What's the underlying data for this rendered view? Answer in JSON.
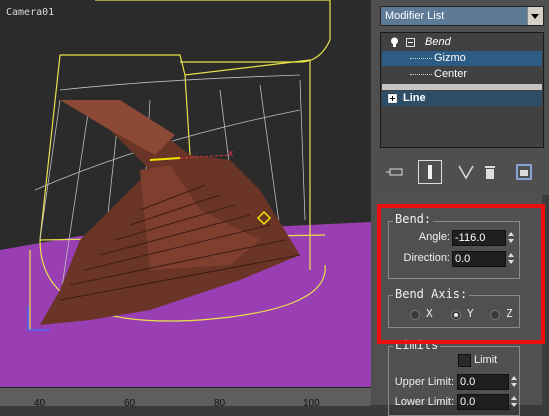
{
  "viewport": {
    "label": "Camera01"
  },
  "ruler": {
    "ticks": [
      "40",
      "60",
      "80",
      "100"
    ]
  },
  "modifier_list": {
    "label": "Modifier List"
  },
  "stack": {
    "items": [
      {
        "label": "Bend",
        "icon": "lightbulb-icon",
        "expander": "minus-icon"
      },
      {
        "label": "Gizmo"
      },
      {
        "label": "Center"
      },
      {
        "label": "Line",
        "expander": "plus-icon"
      }
    ]
  },
  "toolbar": {
    "buttons": [
      "pin-stack-icon",
      "show-end-result-icon",
      "make-unique-icon",
      "remove-modifier-icon",
      "configure-sets-icon"
    ]
  },
  "bend": {
    "title": "Bend:",
    "angle_label": "Angle:",
    "angle_value": "-116.0",
    "direction_label": "Direction:",
    "direction_value": "0.0"
  },
  "bend_axis": {
    "title": "Bend Axis:",
    "options": [
      "X",
      "Y",
      "Z"
    ],
    "selected": "Y"
  },
  "limits": {
    "title": "Limits",
    "limit_label": "Limit",
    "upper_label": "Upper Limit:",
    "upper_value": "0.0",
    "lower_label": "Lower Limit:",
    "lower_value": "0.0"
  },
  "colors": {
    "highlight": "#ea1010",
    "selection": "#2c5b86",
    "floor": "#9b3fb4",
    "gizmo": "#e8e24a"
  }
}
